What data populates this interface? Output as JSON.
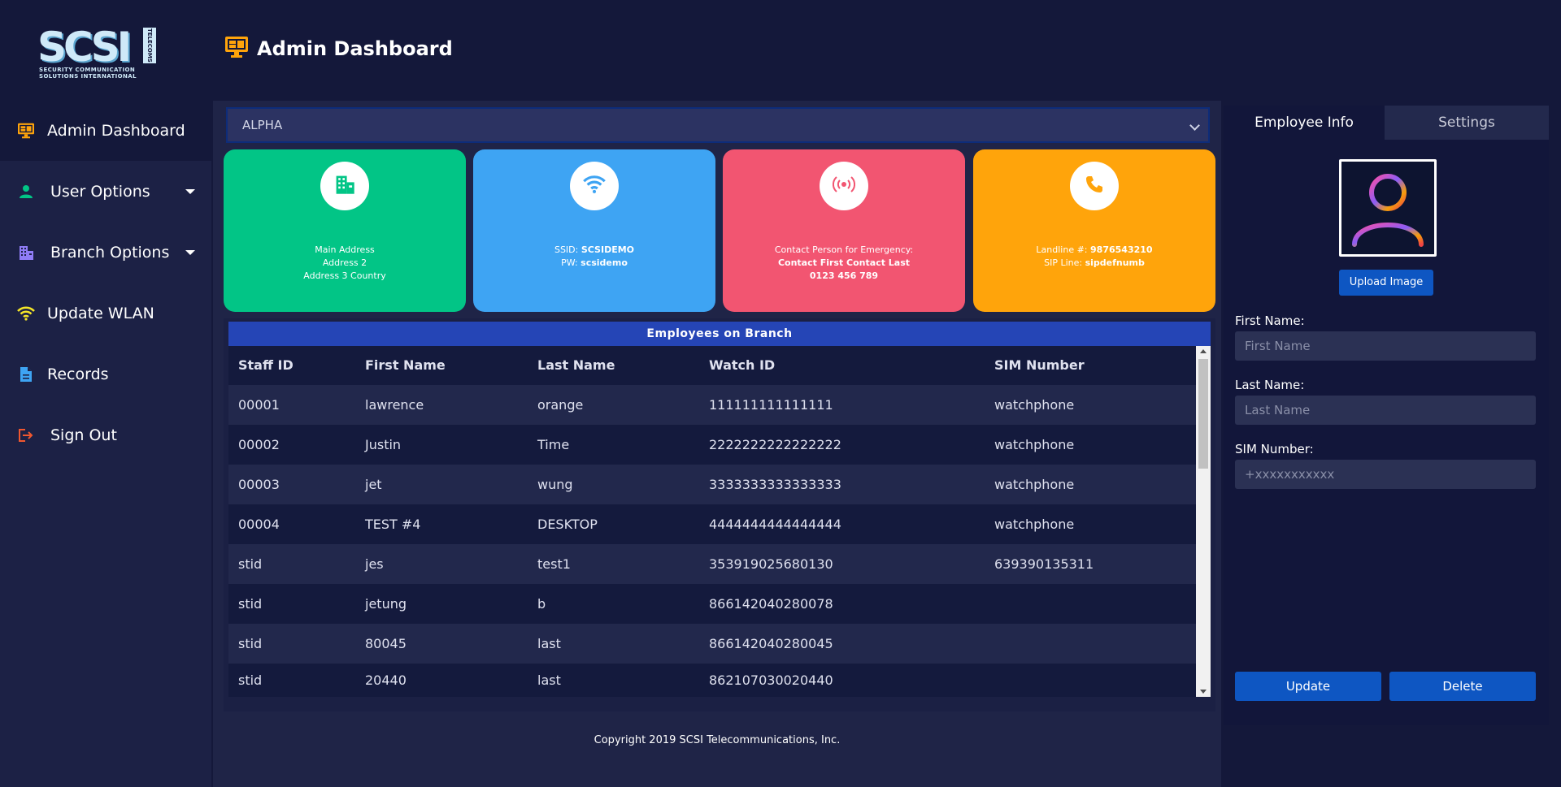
{
  "header": {
    "logo_text": "SCSI",
    "logo_vertical": "TELECOMS",
    "logo_sub": "SECURITY COMMUNICATION\nSOLUTIONS INTERNATIONAL",
    "title": "Admin Dashboard"
  },
  "sidebar": {
    "items": [
      {
        "label": "Admin Dashboard",
        "icon": "monitor-icon",
        "active": true
      },
      {
        "label": "User Options",
        "icon": "user-icon",
        "has_dropdown": true
      },
      {
        "label": "Branch Options",
        "icon": "building-icon",
        "has_dropdown": true
      },
      {
        "label": "Update WLAN",
        "icon": "wifi-icon"
      },
      {
        "label": "Records",
        "icon": "document-icon"
      },
      {
        "label": "Sign Out",
        "icon": "sign-out-icon"
      }
    ]
  },
  "branch_select": {
    "value": "ALPHA"
  },
  "cards": {
    "address": {
      "line1": "Main Address",
      "line2": "Address 2",
      "line3": "Address 3 Country",
      "color": "#02c586"
    },
    "wlan": {
      "ssid_label": "SSID: ",
      "ssid_value": "SCSIDEMO",
      "pw_label": "PW: ",
      "pw_value": "scsidemo",
      "color": "#3ea4f3"
    },
    "emergency": {
      "label": "Contact Person for Emergency:",
      "name": "Contact First Contact Last",
      "phone": "0123 456 789",
      "color": "#f25571"
    },
    "phone": {
      "landline_label": "Landline #: ",
      "landline_value": "9876543210",
      "sip_label": "SIP Line: ",
      "sip_value": "sipdefnumb",
      "color": "#ffa40b"
    }
  },
  "employees": {
    "title": "Employees on Branch",
    "columns": [
      "Staff ID",
      "First Name",
      "Last Name",
      "Watch ID",
      "SIM Number"
    ],
    "rows": [
      [
        "00001",
        "lawrence",
        "orange",
        "111111111111111",
        "watchphone"
      ],
      [
        "00002",
        "Justin",
        "Time",
        "2222222222222222",
        "watchphone"
      ],
      [
        "00003",
        "jet",
        "wung",
        "3333333333333333",
        "watchphone"
      ],
      [
        "00004",
        "TEST #4",
        "DESKTOP",
        "4444444444444444",
        "watchphone"
      ],
      [
        "stid",
        "jes",
        "test1",
        "353919025680130",
        "639390135311"
      ],
      [
        "stid",
        "jetung",
        "b",
        "866142040280078",
        ""
      ],
      [
        "stid",
        "80045",
        "last",
        "866142040280045",
        ""
      ],
      [
        "stid",
        "20440",
        "last",
        "862107030020440",
        ""
      ]
    ]
  },
  "footer": {
    "copyright": "Copyright 2019 SCSI Telecommunications, Inc."
  },
  "right_panel": {
    "tabs": [
      "Employee Info",
      "Settings"
    ],
    "upload_label": "Upload Image",
    "fields": [
      {
        "label": "First Name:",
        "placeholder": "First Name",
        "value": ""
      },
      {
        "label": "Last Name:",
        "placeholder": "Last Name",
        "value": ""
      },
      {
        "label": "SIM Number:",
        "placeholder": "+xxxxxxxxxxx",
        "value": ""
      }
    ],
    "update_label": "Update",
    "delete_label": "Delete"
  }
}
